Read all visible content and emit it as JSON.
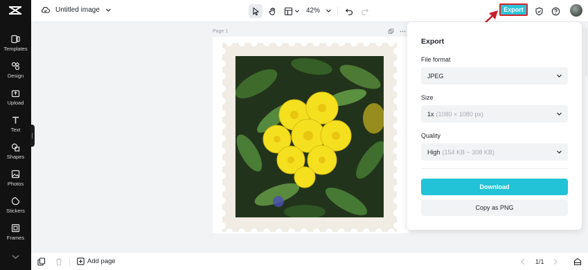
{
  "header": {
    "title": "Untitled image",
    "zoom": "42%",
    "export_label": "Export"
  },
  "sidebar": {
    "items": [
      {
        "label": "Templates",
        "icon": "templates-icon"
      },
      {
        "label": "Design",
        "icon": "design-icon"
      },
      {
        "label": "Upload",
        "icon": "upload-icon"
      },
      {
        "label": "Text",
        "icon": "text-icon"
      },
      {
        "label": "Shapes",
        "icon": "shapes-icon"
      },
      {
        "label": "Photos",
        "icon": "photos-icon"
      },
      {
        "label": "Stickers",
        "icon": "stickers-icon"
      },
      {
        "label": "Frames",
        "icon": "frames-icon"
      }
    ]
  },
  "canvas": {
    "page_label": "Page 1"
  },
  "export_panel": {
    "title": "Export",
    "file_format_label": "File format",
    "file_format_value": "JPEG",
    "size_label": "Size",
    "size_value": "1x",
    "size_detail": "(1080 × 1080 px)",
    "quality_label": "Quality",
    "quality_value": "High",
    "quality_detail": "(154 KB ~ 308 KB)",
    "download_label": "Download",
    "copy_label": "Copy as PNG"
  },
  "footer": {
    "add_page_label": "Add page",
    "pager": "1/1"
  },
  "colors": {
    "accent": "#22c3d6",
    "highlight_border": "#d8232a",
    "sidebar_bg": "#121212"
  }
}
